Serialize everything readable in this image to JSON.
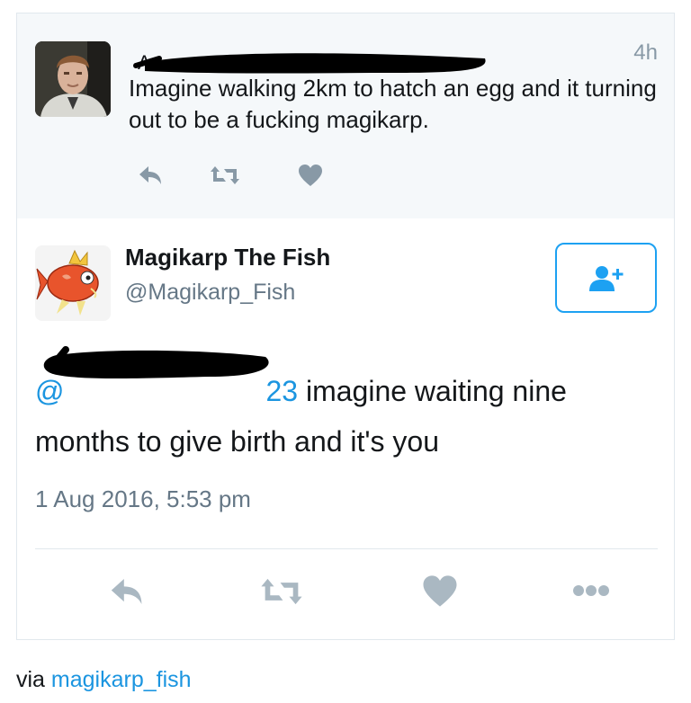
{
  "reply_tweet": {
    "time": "4h",
    "text": "Imagine walking 2km to hatch an egg and it turning out to be a fucking magikarp.",
    "actions": [
      "reply-icon",
      "retweet-icon",
      "like-icon"
    ]
  },
  "main_tweet": {
    "display_name": "Magikarp The Fish",
    "handle": "@Magikarp_Fish",
    "mention_visible": "@",
    "mention_suffix": "23",
    "text": " imagine waiting nine months to give birth and it's you",
    "timestamp": "1 Aug 2016, 5:53 pm",
    "follow_icon": "follow-icon",
    "actions": [
      "reply-icon",
      "retweet-icon",
      "like-icon",
      "more-icon"
    ]
  },
  "footer": {
    "via_prefix": "via",
    "via_link": "magikarp_fish"
  },
  "colors": {
    "accent": "#1da1f2",
    "link": "#1b95e0",
    "icon_gray": "#aab8c2",
    "reply_bg": "#f5f8fa",
    "redaction": "#000000"
  }
}
